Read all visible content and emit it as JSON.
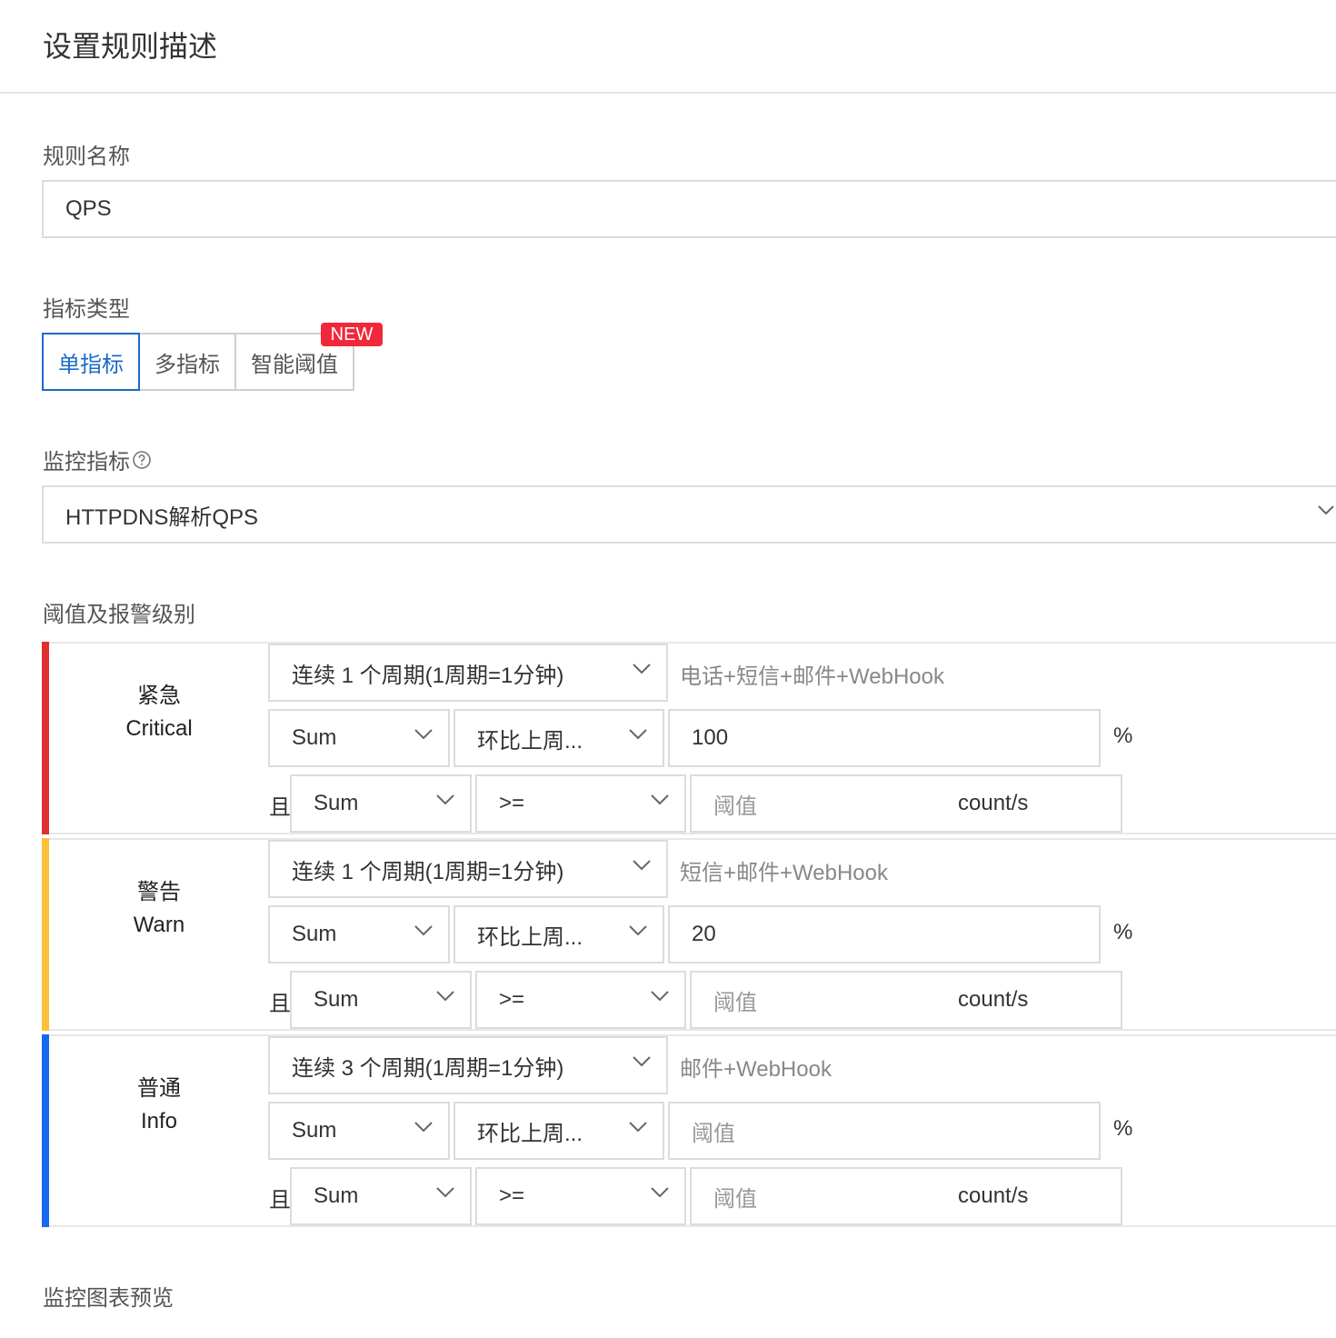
{
  "page": {
    "title": "设置规则描述"
  },
  "rule_name": {
    "label": "规则名称",
    "value": "QPS"
  },
  "metric_type": {
    "label": "指标类型",
    "options": [
      "单指标",
      "多指标",
      "智能阈值"
    ],
    "selected": "单指标",
    "new_badge": "NEW"
  },
  "monitor_metric": {
    "label": "监控指标",
    "value": "HTTPDNS解析QPS"
  },
  "threshold": {
    "label": "阈值及报警级别",
    "and_label": "且",
    "percent_unit": "%",
    "levels": [
      {
        "name_cn": "紧急",
        "name_en": "Critical",
        "color": "#e02f2f",
        "period": "连续 1 个周期(1周期=1分钟)",
        "notify": "电话+短信+邮件+WebHook",
        "stat": "Sum",
        "compare": "环比上周...",
        "value": "100",
        "value_placeholder": "阈值",
        "stat2": "Sum",
        "op2": ">=",
        "value2_placeholder": "阈值",
        "unit2": "count/s"
      },
      {
        "name_cn": "警告",
        "name_en": "Warn",
        "color": "#fbbf3a",
        "period": "连续 1 个周期(1周期=1分钟)",
        "notify": "短信+邮件+WebHook",
        "stat": "Sum",
        "compare": "环比上周...",
        "value": "20",
        "value_placeholder": "阈值",
        "stat2": "Sum",
        "op2": ">=",
        "value2_placeholder": "阈值",
        "unit2": "count/s"
      },
      {
        "name_cn": "普通",
        "name_en": "Info",
        "color": "#1668f0",
        "period": "连续 3 个周期(1周期=1分钟)",
        "notify": "邮件+WebHook",
        "stat": "Sum",
        "compare": "环比上周...",
        "value": "",
        "value_placeholder": "阈值",
        "stat2": "Sum",
        "op2": ">=",
        "value2_placeholder": "阈值",
        "unit2": "count/s"
      }
    ]
  },
  "preview": {
    "label": "监控图表预览"
  }
}
